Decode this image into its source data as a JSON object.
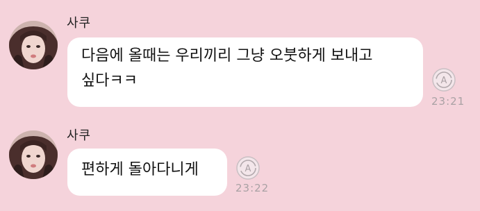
{
  "messages": [
    {
      "sender": "사쿠",
      "lines": [
        "다음에 올때는 우리끼리 그냥 오붓하게 보내고",
        "싶다ㅋㅋ"
      ],
      "time": "23:21"
    },
    {
      "sender": "사쿠",
      "lines": [
        "편하게 돌아다니게"
      ],
      "time": "23:22"
    }
  ],
  "icons": {
    "avatar": "profile-photo",
    "translate": "translate-icon"
  },
  "colors": {
    "background": "#f5d3db",
    "bubble": "#ffffff",
    "time_text": "#a9a1a4"
  }
}
